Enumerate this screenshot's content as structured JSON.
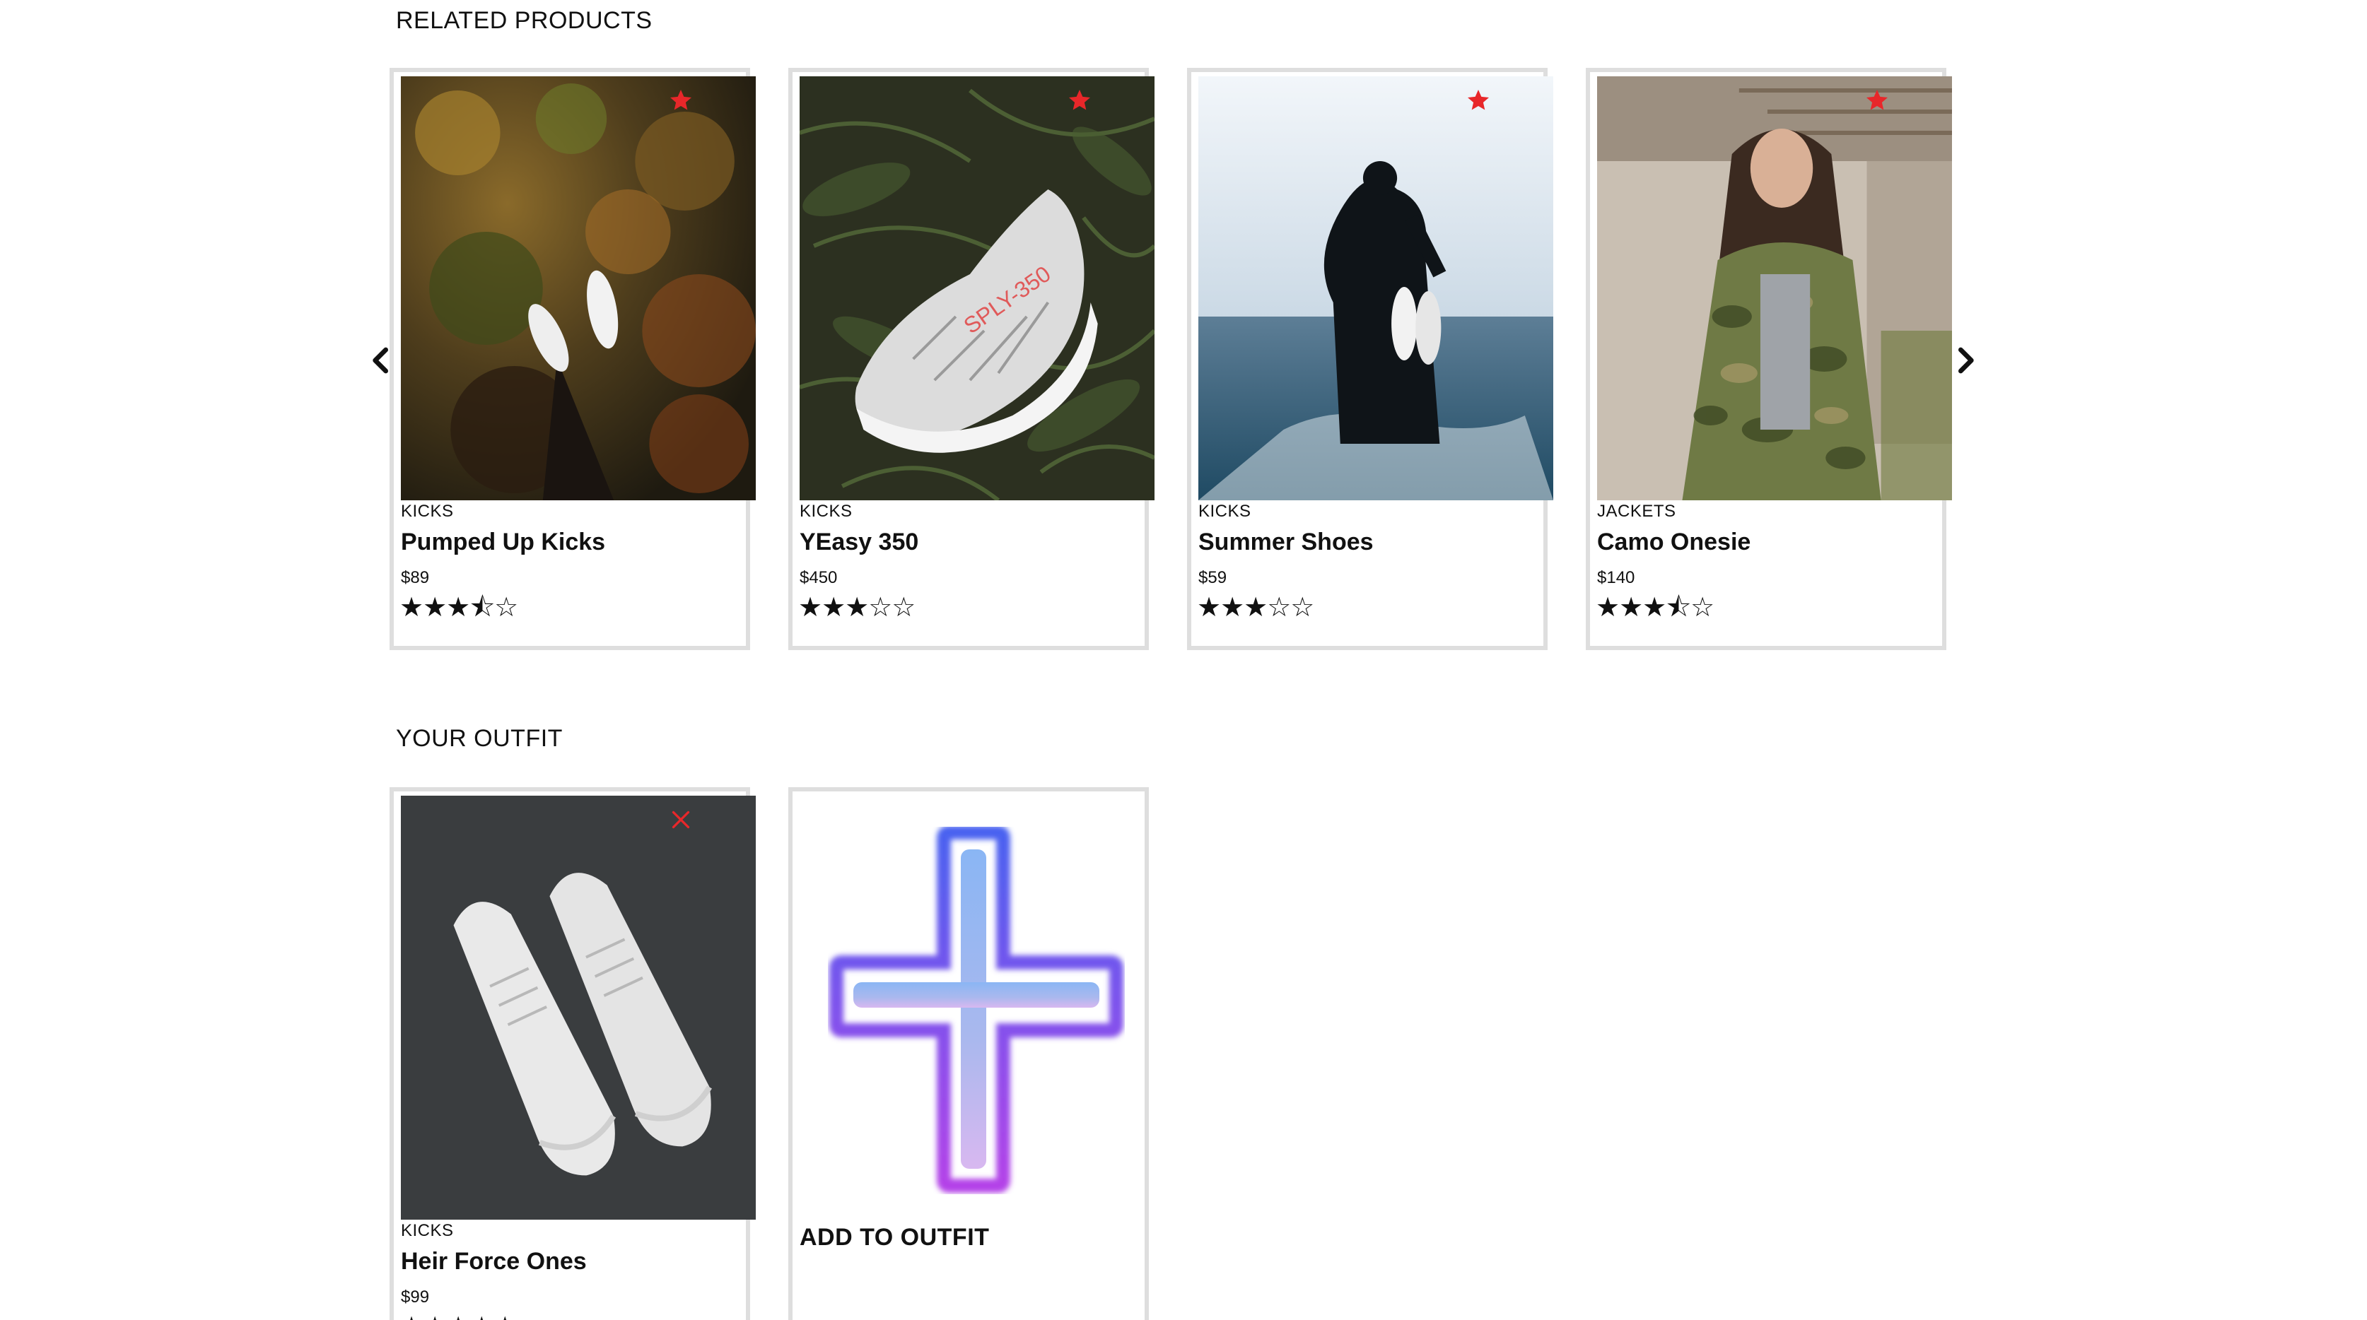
{
  "related": {
    "title": "RELATED PRODUCTS",
    "prev_icon": "chevron-left-icon",
    "next_icon": "chevron-right-icon",
    "action_icon": "star-icon",
    "action_color": "#e8272a",
    "products": [
      {
        "category": "KICKS",
        "name": "Pumped Up Kicks",
        "price": "$89",
        "rating": 3.5,
        "stars": "★★★⯪☆",
        "image": "white sneakers over autumn forest"
      },
      {
        "category": "KICKS",
        "name": "YEasy 350",
        "price": "$450",
        "rating": 3,
        "stars": "★★★☆☆",
        "image": "grey zebra sneaker on fern leaves"
      },
      {
        "category": "KICKS",
        "name": "Summer Shoes",
        "price": "$59",
        "rating": 3,
        "stars": "★★★☆☆",
        "image": "person in sea holding white shoes"
      },
      {
        "category": "JACKETS",
        "name": "Camo Onesie",
        "price": "$140",
        "rating": 3.5,
        "stars": "★★★⯪☆",
        "image": "woman in camo jacket"
      }
    ]
  },
  "outfit": {
    "title": "YOUR OUTFIT",
    "remove_icon": "close-icon",
    "remove_color": "#e8272a",
    "items": [
      {
        "category": "KICKS",
        "name": "Heir Force Ones",
        "price": "$99",
        "stars": "★★★★★"
      }
    ],
    "add_label": "ADD TO OUTFIT",
    "add_icon": "plus-icon"
  }
}
